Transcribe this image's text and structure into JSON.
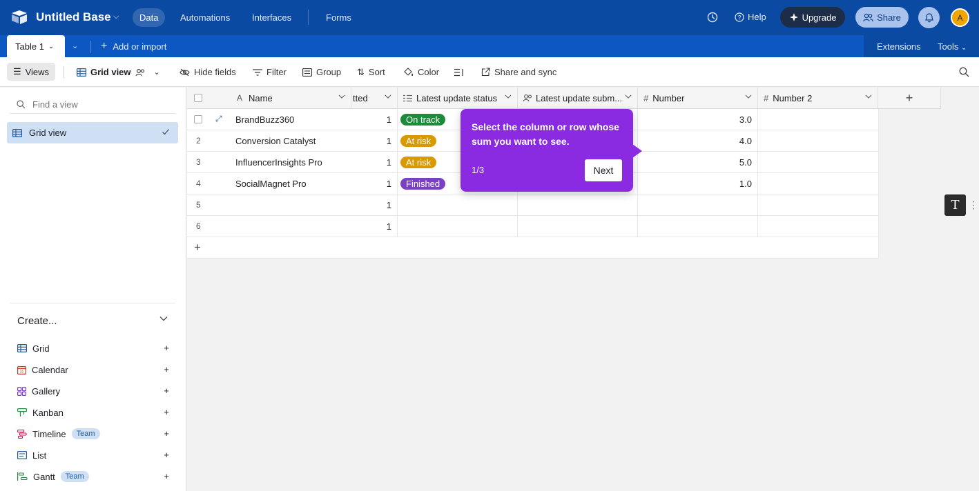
{
  "header": {
    "base_name": "Untitled Base",
    "nav": [
      "Data",
      "Automations",
      "Interfaces",
      "Forms"
    ],
    "help_label": "Help",
    "upgrade_label": "Upgrade",
    "share_label": "Share",
    "avatar_initial": "A"
  },
  "tabs": {
    "active_table": "Table 1",
    "add_import": "Add or import",
    "extensions": "Extensions",
    "tools": "Tools"
  },
  "toolbar": {
    "views": "Views",
    "grid_view": "Grid view",
    "hide_fields": "Hide fields",
    "filter": "Filter",
    "group": "Group",
    "sort": "Sort",
    "color": "Color",
    "share_sync": "Share and sync"
  },
  "sidebar": {
    "find_placeholder": "Find a view",
    "active_view": "Grid view",
    "create_title": "Create...",
    "create_items": [
      {
        "label": "Grid",
        "icon": "grid-icon",
        "color": "#1e5a9c"
      },
      {
        "label": "Calendar",
        "icon": "calendar-icon",
        "color": "#c0392b"
      },
      {
        "label": "Gallery",
        "icon": "gallery-icon",
        "color": "#7b3fc4"
      },
      {
        "label": "Kanban",
        "icon": "kanban-icon",
        "color": "#2b8a3e"
      },
      {
        "label": "Timeline",
        "icon": "timeline-icon",
        "color": "#c2185b",
        "badge": "Team"
      },
      {
        "label": "List",
        "icon": "list-icon",
        "color": "#1e5a9c"
      },
      {
        "label": "Gantt",
        "icon": "gantt-icon",
        "color": "#2b8a3e",
        "badge": "Team"
      }
    ]
  },
  "grid": {
    "columns": {
      "name": "Name",
      "submitted_partial": "tted",
      "status": "Latest update status",
      "submitter": "Latest update subm...",
      "number": "Number",
      "number2": "Number 2"
    },
    "rows": [
      {
        "index": "",
        "name": "BrandBuzz360",
        "count": "1",
        "status": "On track",
        "status_color": "#1e8a3c",
        "number": "3.0"
      },
      {
        "index": "2",
        "name": "Conversion Catalyst",
        "count": "1",
        "status": "At risk",
        "status_color": "#d99a00",
        "number": "4.0"
      },
      {
        "index": "3",
        "name": "InfluencerInsights Pro",
        "count": "1",
        "status": "At risk",
        "status_color": "#d99a00",
        "number": "5.0"
      },
      {
        "index": "4",
        "name": "SocialMagnet Pro",
        "count": "1",
        "status": "Finished",
        "status_color": "#7b3fc4",
        "number": "1.0"
      },
      {
        "index": "5",
        "name": "",
        "count": "1",
        "status": "",
        "status_color": "",
        "number": ""
      },
      {
        "index": "6",
        "name": "",
        "count": "1",
        "status": "",
        "status_color": "",
        "number": ""
      }
    ]
  },
  "tooltip": {
    "text": "Select the column or row whose sum you want to see.",
    "step": "1/3",
    "next": "Next"
  },
  "floating": {
    "text_tool": "T"
  }
}
